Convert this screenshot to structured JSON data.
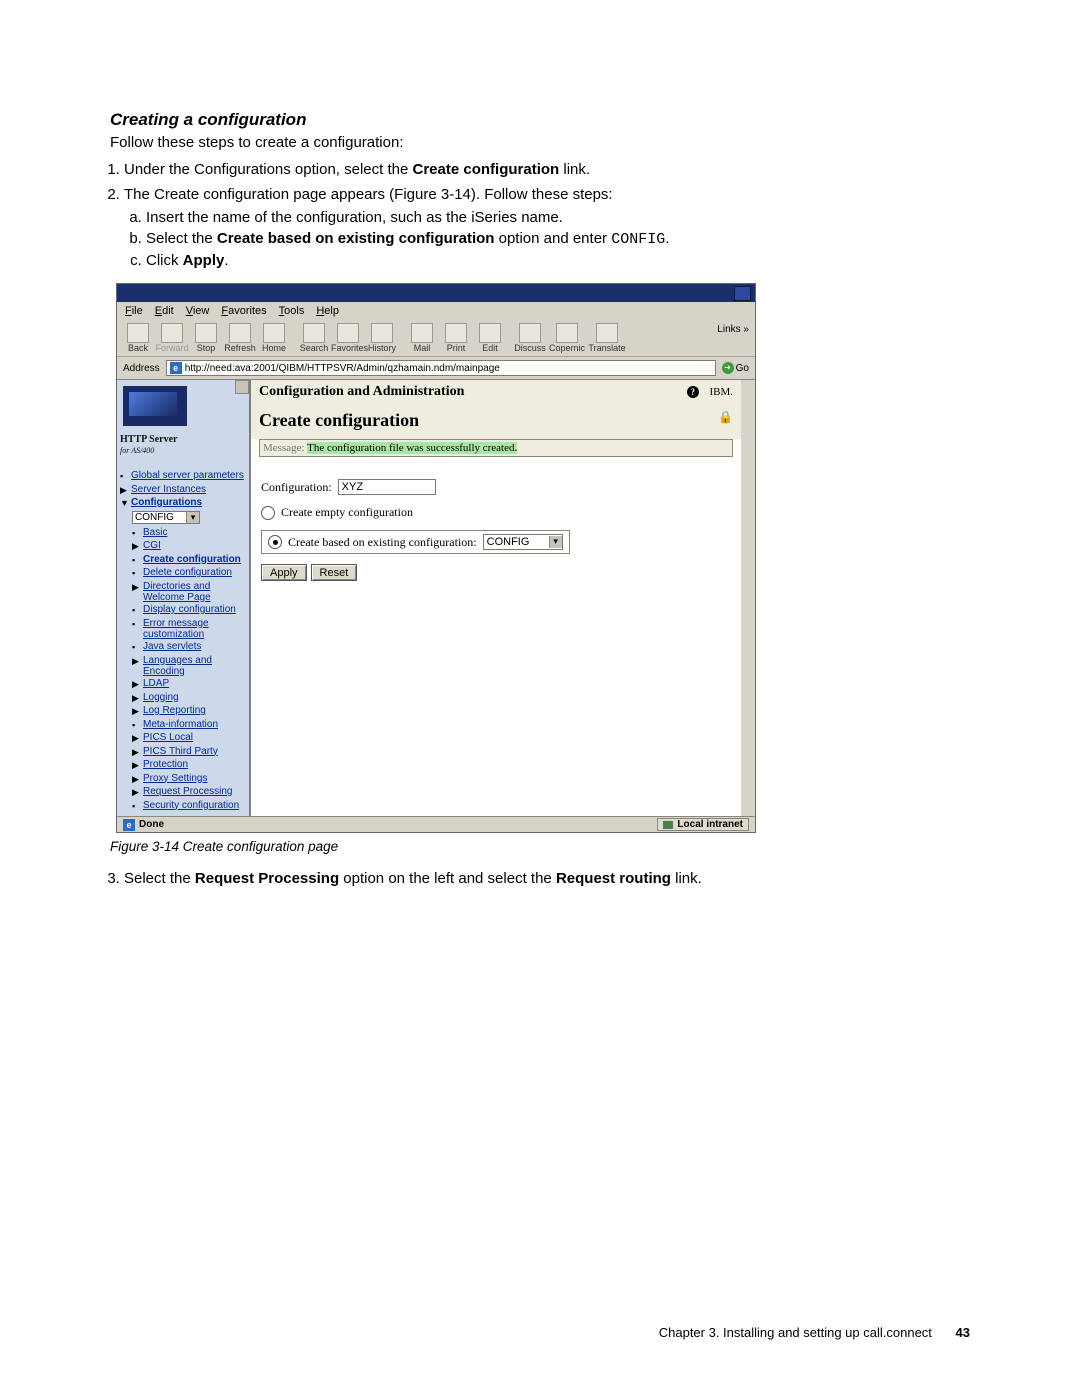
{
  "heading": "Creating a configuration",
  "intro": "Follow these steps to create a configuration:",
  "step1_pre": "Under the Configurations option, select the ",
  "step1_bold": "Create configuration",
  "step1_post": " link.",
  "step2": "The Create configuration page appears (Figure 3-14). Follow these steps:",
  "step2a": "Insert the name of the configuration, such as the iSeries name.",
  "step2b_pre": "Select the ",
  "step2b_bold": "Create based on existing configuration",
  "step2b_mid": " option and enter ",
  "step2b_code": "CONFIG",
  "step2b_post": ".",
  "step2c_pre": "Click ",
  "step2c_bold": "Apply",
  "step2c_post": ".",
  "figcap": "Figure 3-14   Create configuration page",
  "step3_pre": "Select the ",
  "step3_bold1": "Request Processing",
  "step3_mid": " option on the left and select the ",
  "step3_bold2": "Request routing",
  "step3_post": " link.",
  "footer": {
    "chapter": "Chapter 3. Installing and setting up call.connect",
    "page": "43"
  },
  "ie": {
    "menu": [
      "File",
      "Edit",
      "View",
      "Favorites",
      "Tools",
      "Help"
    ],
    "toolbar": [
      "Back",
      "Forward",
      "Stop",
      "Refresh",
      "Home",
      "Search",
      "Favorites",
      "History",
      "Mail",
      "Print",
      "Edit",
      "Discuss",
      "Copernic",
      "Translate"
    ],
    "links_label": "Links",
    "addr_label": "Address",
    "addr_value": "http://need:ava:2001/QIBM/HTTPSVR/Admin/qzhamain.ndm/mainpage",
    "go_label": "Go",
    "status_done": "Done",
    "status_zone": "Local intranet"
  },
  "left": {
    "product": "HTTP Server",
    "product_sub": "for AS/400",
    "items": {
      "global": "Global server parameters",
      "server_inst": "Server Instances",
      "configs": "Configurations",
      "config_selected": "CONFIG",
      "basic": "Basic",
      "cgi": "CGI",
      "create_config": "Create configuration",
      "delete_config": "Delete configuration",
      "dirs_welcome": "Directories and Welcome Page",
      "display_config": "Display configuration",
      "error_cust": "Error message customization",
      "java": "Java servlets",
      "lang": "Languages and Encoding",
      "ldap": "LDAP",
      "logging": "Logging",
      "logrep": "Log Reporting",
      "meta": "Meta-information",
      "pics_local": "PICS Local",
      "pics_third": "PICS Third Party",
      "protection": "Protection",
      "proxy": "Proxy Settings",
      "reqproc": "Request Processing",
      "security": "Security configuration"
    }
  },
  "right": {
    "title": "Configuration and Administration",
    "subtitle": "Create configuration",
    "ibm": "IBM.",
    "msg_label": "Message:",
    "msg_text": "The configuration file was successfully created.",
    "form": {
      "config_lbl": "Configuration:",
      "config_val": "XYZ",
      "opt_empty": "Create empty configuration",
      "opt_based": "Create based on existing configuration:",
      "based_val": "CONFIG",
      "apply": "Apply",
      "reset": "Reset"
    }
  }
}
